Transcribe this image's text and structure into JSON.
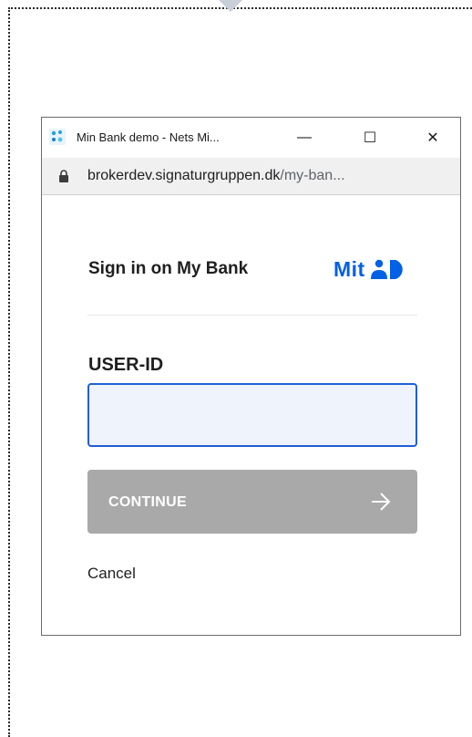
{
  "window": {
    "title": "Min Bank demo - Nets Mi...",
    "controls": {
      "minimize_glyph": "—",
      "maximize_glyph": "☐",
      "close_glyph": "✕"
    }
  },
  "address_bar": {
    "host": "brokerdev.signaturgruppen.dk",
    "path": "/my-ban..."
  },
  "login": {
    "title": "Sign in on My Bank",
    "logo_text": "Mit",
    "user_id_label": "USER-ID",
    "user_id_value": "",
    "continue_label": "CONTINUE",
    "cancel_label": "Cancel"
  },
  "colors": {
    "brand_blue": "#0060e6",
    "input_border": "#1f5fd6",
    "input_bg": "#eef3fc",
    "button_disabled": "#a9a9a9"
  },
  "icons": {
    "app": "nets-app-icon",
    "lock": "lock-icon",
    "logo_mark": "mitid-person-d-icon",
    "arrow": "arrow-right-icon"
  }
}
